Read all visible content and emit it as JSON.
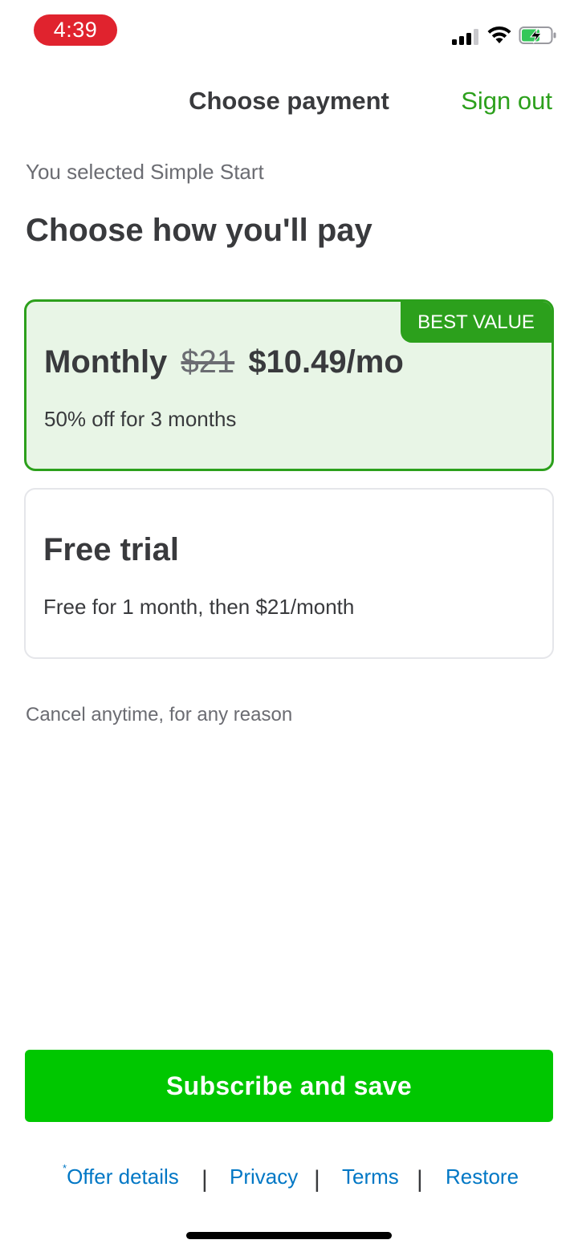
{
  "status_bar": {
    "time": "4:39",
    "icons": [
      "cellular-signal-icon",
      "wifi-icon",
      "battery-charging-icon"
    ]
  },
  "header": {
    "title": "Choose payment",
    "sign_out_label": "Sign out"
  },
  "selected_plan_text": "You selected Simple Start",
  "section_heading": "Choose how you'll pay",
  "options": [
    {
      "badge": "BEST VALUE",
      "title": "Monthly",
      "old_price": "$21",
      "new_price": "$10.49/mo",
      "subtitle": "50% off for 3 months",
      "selected": true
    },
    {
      "title": "Free trial",
      "subtitle": "Free for 1 month, then $21/month",
      "selected": false
    }
  ],
  "cancel_note": "Cancel anytime, for any reason",
  "subscribe_button_label": "Subscribe and save",
  "footer": {
    "offer_marker": "*",
    "offer_details": "Offer details",
    "separator": "|",
    "privacy": "Privacy",
    "terms": "Terms",
    "restore": "Restore"
  },
  "colors": {
    "brand_green": "#2ca01c",
    "button_green": "#00c700",
    "selected_card_bg": "#e8f5e6",
    "link_blue": "#0077c5",
    "time_pill_red": "#e0232e",
    "text_dark": "#393a3d",
    "text_muted": "#6b6c72"
  }
}
